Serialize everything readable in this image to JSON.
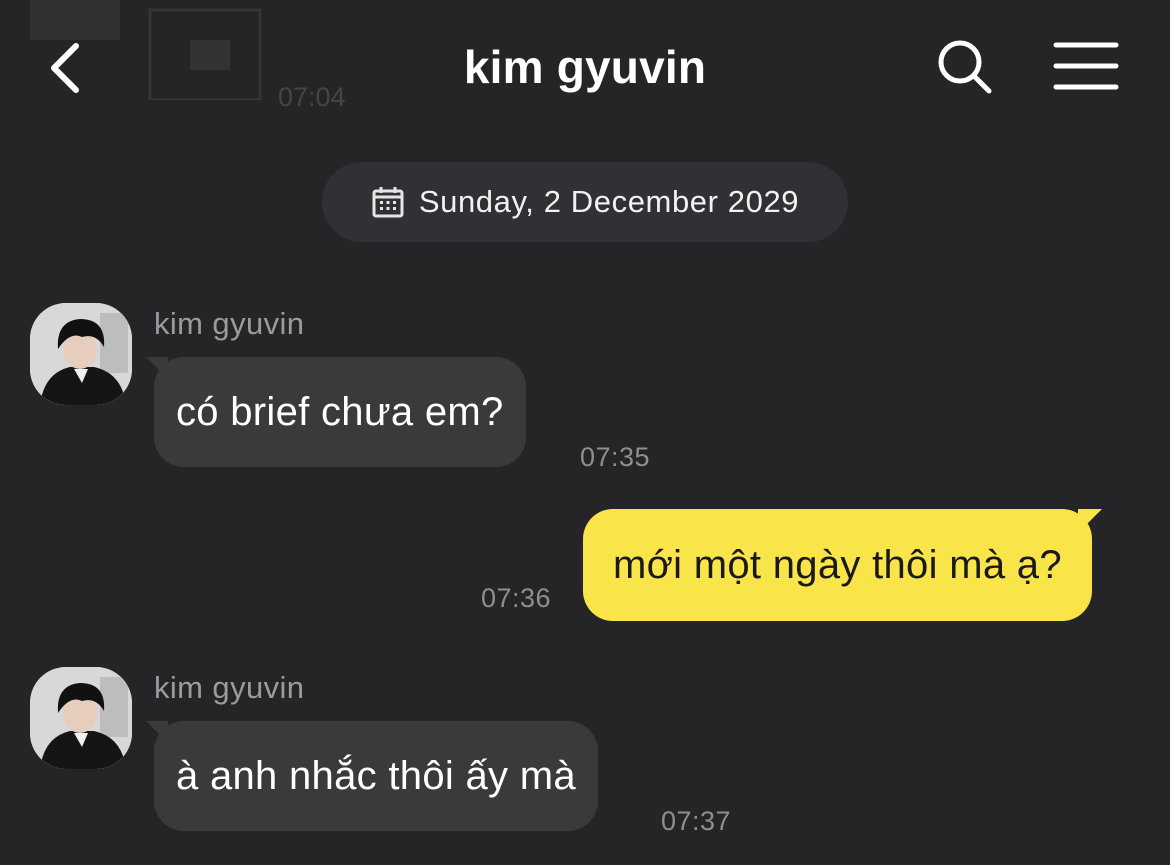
{
  "header": {
    "title": "kim gyuvin",
    "back_icon": "chevron-left-icon",
    "search_icon": "search-icon",
    "menu_icon": "hamburger-menu-icon"
  },
  "ghost": {
    "time": "07:04"
  },
  "date_divider": {
    "icon": "calendar-icon",
    "text": "Sunday, 2 December 2029"
  },
  "messages": [
    {
      "direction": "incoming",
      "sender": "kim gyuvin",
      "text": "có brief chưa em?",
      "time": "07:35"
    },
    {
      "direction": "outgoing",
      "text": "mới một ngày thôi mà ạ?",
      "time": "07:36"
    },
    {
      "direction": "incoming",
      "sender": "kim gyuvin",
      "text": "à anh nhắc thôi ấy mà",
      "time": "07:37"
    }
  ],
  "colors": {
    "background": "#252528",
    "incoming_bubble": "#3a3a3d",
    "outgoing_bubble": "#f9e44a",
    "timestamp": "#8e8e93",
    "sender_name": "#9a9a9f"
  }
}
